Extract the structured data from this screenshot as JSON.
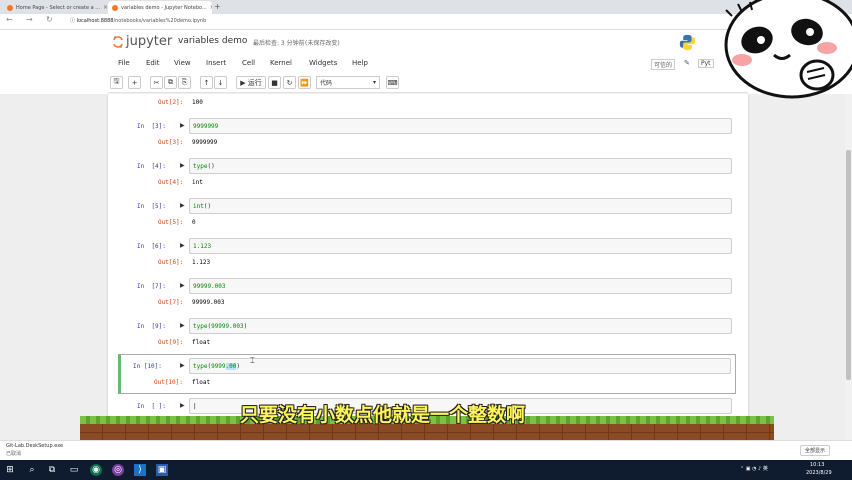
{
  "browser": {
    "tabs": [
      {
        "label": "Home Page - Select or create a ...",
        "active": false,
        "fav_color": "#f37726"
      },
      {
        "label": "variables demo - Jupyter Notebo...",
        "active": true,
        "fav_color": "#f37726"
      }
    ],
    "new_tab": "+",
    "url_host": "localhost:8888",
    "url_path": "/notebooks/variables%20demo.ipynb"
  },
  "jupyter": {
    "logo_text": "jupyter",
    "notebook_name": "variables demo",
    "checkpoint": "最后检查: 3 分钟前",
    "autosave": "(未保存改变)",
    "menu": [
      "File",
      "Edit",
      "View",
      "Insert",
      "Cell",
      "Kernel",
      "Widgets",
      "Help"
    ],
    "trusted": "可信的",
    "kernel": "Pyt",
    "toolbar": {
      "save": "🖫",
      "add": "+",
      "cut": "✂",
      "copy": "⧉",
      "paste": "⎘",
      "up": "↑",
      "down": "↓",
      "run": "▶ 运行",
      "stop": "■",
      "restart": "↻",
      "restart_run": "⏩",
      "cell_type": "代码",
      "keyboard": "⌨"
    }
  },
  "cells": [
    {
      "out_prompt": "Out[2]:",
      "output": "100"
    },
    {
      "in_prompt": "In  [3]:",
      "code_tokens": [
        {
          "t": "9999999",
          "c": "num"
        }
      ],
      "out_prompt": "Out[3]:",
      "output": "9999999"
    },
    {
      "in_prompt": "In  [4]:",
      "code_tokens": [
        {
          "t": "type",
          "c": "fn"
        },
        {
          "t": "()",
          "c": "paren"
        }
      ],
      "out_prompt": "Out[4]:",
      "output": "int"
    },
    {
      "in_prompt": "In  [5]:",
      "code_tokens": [
        {
          "t": "int",
          "c": "fn"
        },
        {
          "t": "()",
          "c": "paren"
        }
      ],
      "out_prompt": "Out[5]:",
      "output": "0"
    },
    {
      "in_prompt": "In  [6]:",
      "code_tokens": [
        {
          "t": "1.123",
          "c": "num"
        }
      ],
      "out_prompt": "Out[6]:",
      "output": "1.123"
    },
    {
      "in_prompt": "In  [7]:",
      "code_tokens": [
        {
          "t": "99999.003",
          "c": "num"
        }
      ],
      "out_prompt": "Out[7]:",
      "output": "99999.003"
    },
    {
      "in_prompt": "In  [9]:",
      "code_tokens": [
        {
          "t": "type",
          "c": "fn"
        },
        {
          "t": "(",
          "c": "paren"
        },
        {
          "t": "99999.003",
          "c": "num"
        },
        {
          "t": ")",
          "c": "paren"
        }
      ],
      "out_prompt": "Out[9]:",
      "output": "float"
    },
    {
      "in_prompt": "In [10]:",
      "code_tokens": [
        {
          "t": "type",
          "c": "fn"
        },
        {
          "t": "(",
          "c": "paren"
        },
        {
          "t": "9999",
          "c": "num"
        },
        {
          "t": ".00",
          "c": "sel"
        },
        {
          "t": ")",
          "c": "paren"
        }
      ],
      "out_prompt": "Out[10]:",
      "output": "float",
      "selected": true
    },
    {
      "in_prompt": "In  [ ]:",
      "code_tokens": []
    }
  ],
  "subtitle": "只要没有小数点他就是一个整数啊",
  "download": {
    "file": "Git-Lab.DeskSetup.exe",
    "status": "已取消",
    "show_all": "全部显示"
  },
  "taskbar": {
    "time": "10:13",
    "date": "2023/8/29"
  }
}
